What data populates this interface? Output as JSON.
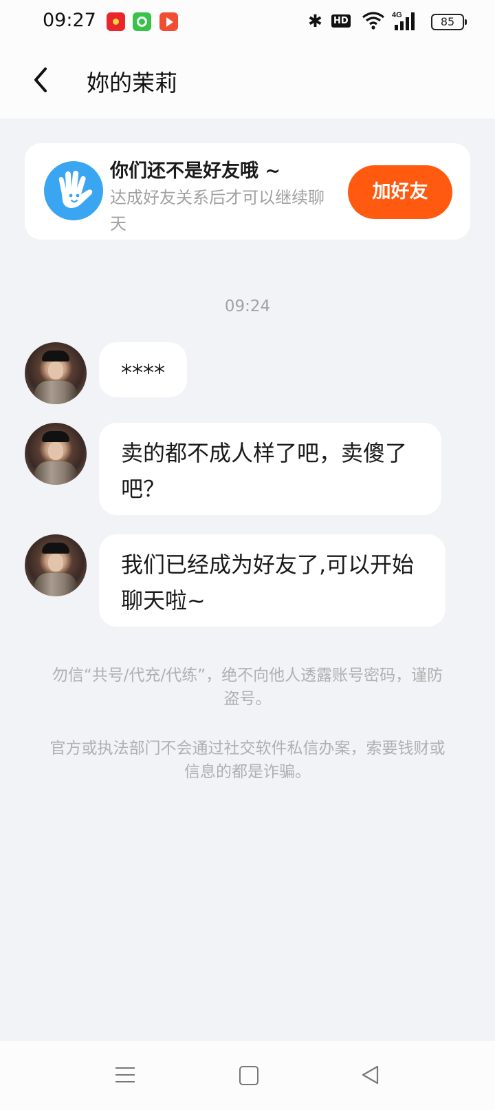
{
  "status_bar": {
    "time": "09:27",
    "hd": "HD",
    "network": "4G",
    "battery": "85",
    "icons": [
      "red-packet-app-icon",
      "green-app-icon",
      "video-app-icon",
      "bluetooth-icon",
      "hd-icon",
      "wifi-icon",
      "cellular-signal-icon",
      "battery-icon"
    ]
  },
  "header": {
    "title": "妳的茉莉",
    "back_icon": "chevron-left-icon"
  },
  "friend_card": {
    "title": "你们还不是好友哦 ~",
    "subtitle": "达成好友关系后才可以继续聊天",
    "button_label": "加好友",
    "icon": "waving-hand-icon",
    "accent_color": "#ff5a10"
  },
  "chat": {
    "timestamp": "09:24",
    "messages": [
      {
        "text": "****"
      },
      {
        "text": "卖的都不成人样了吧，卖傻了吧？"
      },
      {
        "text": "我们已经成为好友了,可以开始聊天啦~"
      }
    ]
  },
  "notices": [
    "勿信“共号/代充/代练”，绝不向他人透露账号密码，谨防盗号。",
    "官方或执法部门不会通过社交软件私信办案，索要钱财或信息的都是诈骗。"
  ],
  "nav_bar": {
    "icons": [
      "menu-icon",
      "home-icon",
      "back-triangle-icon"
    ]
  }
}
